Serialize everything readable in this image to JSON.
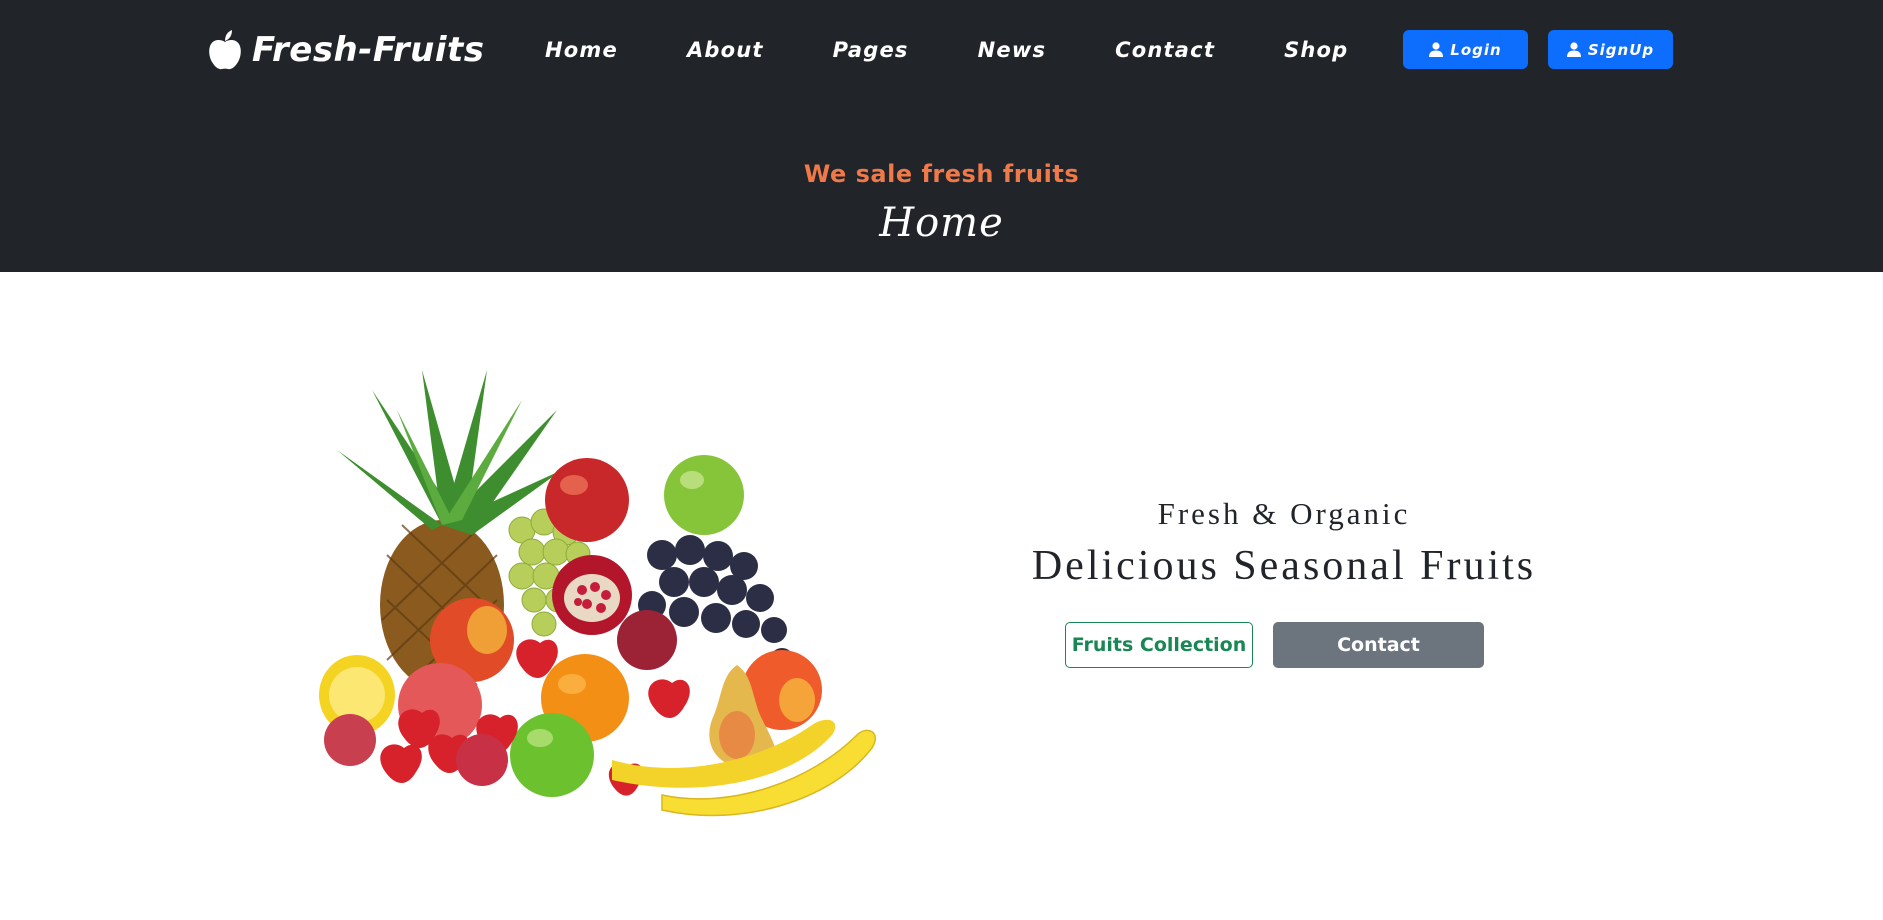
{
  "navbar": {
    "brand": {
      "name": "Fresh-Fruits",
      "icon": "apple-icon"
    },
    "links": [
      {
        "label": "Home"
      },
      {
        "label": "About"
      },
      {
        "label": "Pages"
      },
      {
        "label": "News"
      },
      {
        "label": "Contact"
      },
      {
        "label": "Shop"
      }
    ],
    "auth": {
      "login_label": "Login",
      "signup_label": "SignUp",
      "icon": "user-icon"
    }
  },
  "banner": {
    "tagline": "We sale fresh fruits",
    "heading": "Home"
  },
  "hero": {
    "image_icon": "fruit-assortment-image",
    "subtitle": "Fresh & Organic",
    "title": "Delicious Seasonal Fruits",
    "primary_button": "Fruits Collection",
    "secondary_button": "Contact"
  },
  "colors": {
    "dark_bg": "#212429",
    "accent_orange": "#f0794a",
    "brand_blue": "#0d6efd",
    "success_green": "#198754",
    "secondary_gray": "#6c757d"
  }
}
